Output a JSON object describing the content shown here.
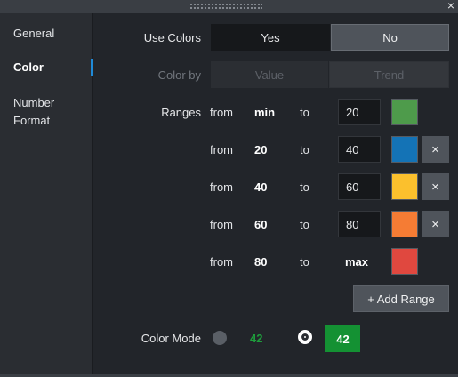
{
  "window": {
    "close_glyph": "×"
  },
  "sidebar": {
    "items": [
      {
        "label": "General"
      },
      {
        "label": "Color"
      },
      {
        "label": "Number"
      },
      {
        "label": "Format"
      }
    ]
  },
  "use_colors": {
    "label": "Use Colors",
    "options": [
      "Yes",
      "No"
    ],
    "selected": "No"
  },
  "color_by": {
    "label": "Color by",
    "options": [
      "Value",
      "Trend"
    ],
    "enabled": false
  },
  "ranges": {
    "label": "Ranges",
    "from_label": "from",
    "to_label": "to",
    "rows": [
      {
        "from": "min",
        "to": "20",
        "color": "#4e9b4b",
        "removable": false
      },
      {
        "from": "20",
        "to": "40",
        "color": "#1473b6",
        "removable": true
      },
      {
        "from": "40",
        "to": "60",
        "color": "#fbc02d",
        "removable": true
      },
      {
        "from": "60",
        "to": "80",
        "color": "#f57c34",
        "removable": true
      },
      {
        "from": "80",
        "to": "max",
        "color": "#e0483f",
        "removable": false
      }
    ],
    "remove_glyph": "×",
    "add_label": "+ Add Range"
  },
  "color_mode": {
    "label": "Color Mode",
    "option_text": "42",
    "option_text_2": "42",
    "text_color": "#1e9e3c",
    "fill_color": "#149133",
    "selected": "filled"
  }
}
